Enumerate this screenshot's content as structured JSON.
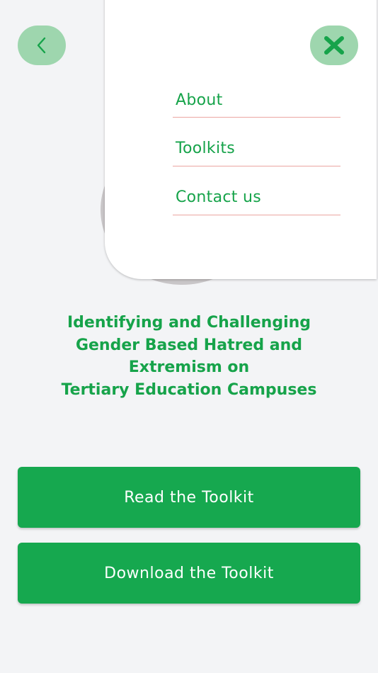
{
  "menu": {
    "items": [
      {
        "label": "About"
      },
      {
        "label": "Toolkits"
      },
      {
        "label": "Contact us"
      }
    ]
  },
  "main": {
    "title_lines": [
      "Identifying and Challenging",
      "Gender Based Hatred and",
      "Extremism on",
      "Tertiary Education Campuses"
    ]
  },
  "actions": {
    "read_label": "Read the Toolkit",
    "download_label": "Download the Toolkit"
  },
  "icons": {
    "back": "chevron-left-icon",
    "close": "close-icon"
  },
  "colors": {
    "brand_green": "#16a34a",
    "button_green": "#16a84f",
    "icon_button_bg": "#9ed6ae",
    "divider": "#eba6a2",
    "background": "#f3f4f6"
  }
}
